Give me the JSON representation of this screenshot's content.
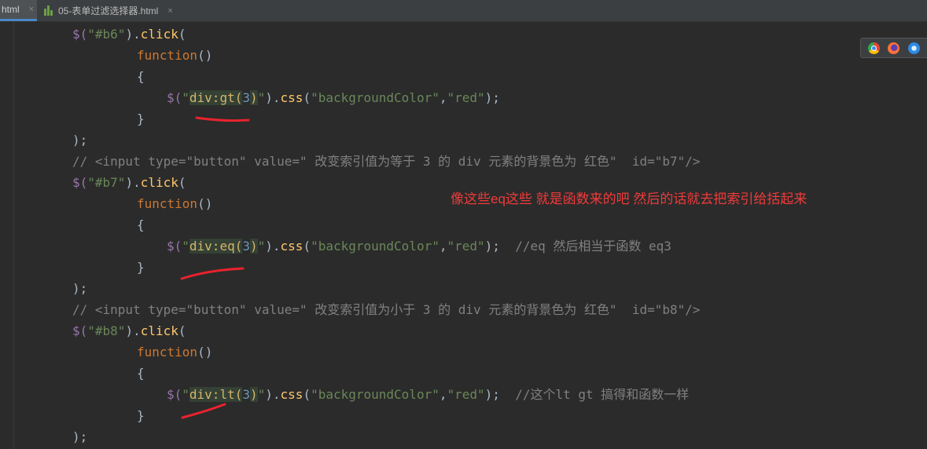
{
  "tabs": [
    {
      "label": "html",
      "active": true
    },
    {
      "label": "05-表单过滤选择器.html",
      "active": false
    }
  ],
  "tab_close_glyph": "×",
  "code": {
    "l1": {
      "a": "$(",
      "b": "\"#b6\"",
      "c": ").",
      "d": "click",
      "e": "("
    },
    "l2": {
      "kw": "function",
      "p": "()"
    },
    "l3": "{",
    "l4": {
      "a": "$(",
      "q1": "\"",
      "sel": "div:gt(",
      "num": "3",
      "sel2": ")",
      "q2": "\"",
      "c": ").",
      "fn": "css",
      "o": "(",
      "s1": "\"backgroundColor\"",
      "cm": ",",
      "s2": "\"red\"",
      "e": ");"
    },
    "l5": "}",
    "l6": ");",
    "l7": "// <input type=\"button\" value=\" 改变索引值为等于 3 的 div 元素的背景色为 红色\"  id=\"b7\"/>",
    "l8": {
      "a": "$(",
      "b": "\"#b7\"",
      "c": ").",
      "d": "click",
      "e": "("
    },
    "l9": {
      "kw": "function",
      "p": "()"
    },
    "l10": "{",
    "l11": {
      "a": "$(",
      "q1": "\"",
      "sel": "div:eq(",
      "num": "3",
      "sel2": ")",
      "q2": "\"",
      "c": ").",
      "fn": "css",
      "o": "(",
      "s1": "\"backgroundColor\"",
      "cm": ",",
      "s2": "\"red\"",
      "e": ");",
      "comment": "  //eq 然后相当于函数 eq3"
    },
    "l12": "}",
    "l13": ");",
    "l14": "// <input type=\"button\" value=\" 改变索引值为小于 3 的 div 元素的背景色为 红色\"  id=\"b8\"/>",
    "l15": {
      "a": "$(",
      "b": "\"#b8\"",
      "c": ").",
      "d": "click",
      "e": "("
    },
    "l16": {
      "kw": "function",
      "p": "()"
    },
    "l17": "{",
    "l18": {
      "a": "$(",
      "q1": "\"",
      "sel": "div:lt(",
      "num": "3",
      "sel2": ")",
      "q2": "\"",
      "c": ").",
      "fn": "css",
      "o": "(",
      "s1": "\"backgroundColor\"",
      "cm": ",",
      "s2": "\"red\"",
      "e": ");",
      "comment": "  //这个lt gt 搞得和函数一样"
    },
    "l19": "}",
    "l20": ");"
  },
  "annotation": "像这些eq这些 就是函数来的吧 然后的话就去把索引给括起来",
  "browser_icons": [
    "chrome-icon",
    "firefox-icon",
    "safari-icon"
  ],
  "colors": {
    "background": "#2b2b2b",
    "string": "#6a8759",
    "keyword": "#cc7832",
    "function": "#ffc66d",
    "number": "#6897bb",
    "comment": "#808080",
    "annotation_red": "#f03a3a",
    "underline_red": "#e8232e"
  }
}
